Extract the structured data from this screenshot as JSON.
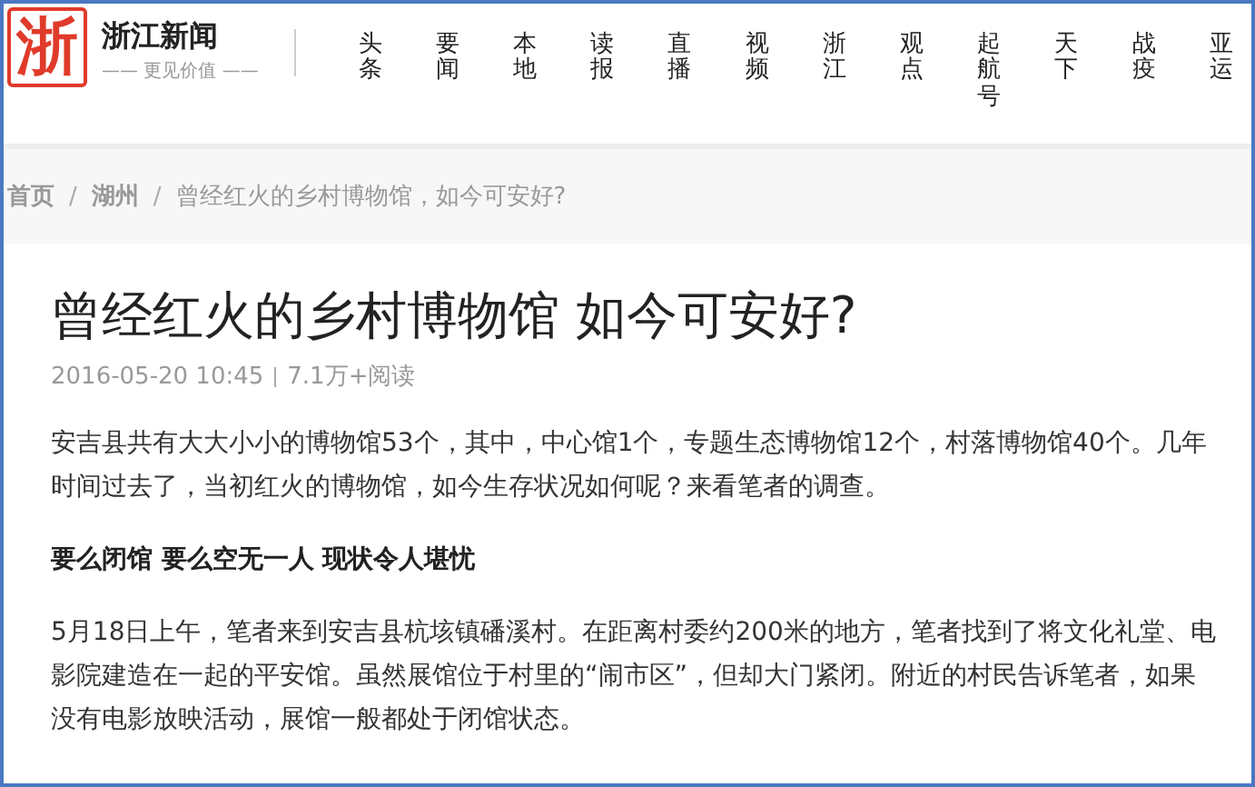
{
  "logo": {
    "mark": "浙",
    "name": "浙江新闻",
    "tagline": "—— 更见价值 ——"
  },
  "nav": [
    "头条",
    "要闻",
    "本地",
    "读报",
    "直播",
    "视频",
    "浙江",
    "观点",
    "起航号",
    "天下",
    "战疫",
    "亚运"
  ],
  "breadcrumb": {
    "separator": "/",
    "items": [
      {
        "label": "首页",
        "kind": "link"
      },
      {
        "label": "湖州",
        "kind": "link"
      },
      {
        "label": "曾经红火的乡村博物馆，如今可安好?",
        "kind": "current"
      }
    ]
  },
  "article": {
    "title": "曾经红火的乡村博物馆 如今可安好?",
    "date": "2016-05-20 10:45",
    "views": "7.1万+阅读",
    "blocks": [
      {
        "kind": "paragraph",
        "text": "安吉县共有大大小小的博物馆53个，其中，中心馆1个，专题生态博物馆12个，村落博物馆40个。几年时间过去了，当初红火的博物馆，如今生存状况如何呢？来看笔者的调查。"
      },
      {
        "kind": "heading",
        "text": "要么闭馆 要么空无一人 现状令人堪忧"
      },
      {
        "kind": "paragraph",
        "text": "5月18日上午，笔者来到安吉县杭垓镇磻溪村。在距离村委约200米的地方，笔者找到了将文化礼堂、电影院建造在一起的平安馆。虽然展馆位于村里的“闹市区”，但却大门紧闭。附近的村民告诉笔者，如果没有电影放映活动，展馆一般都处于闭馆状态。"
      }
    ]
  }
}
